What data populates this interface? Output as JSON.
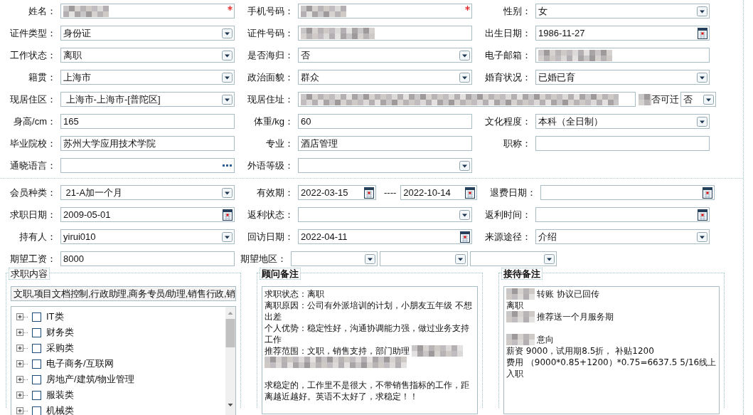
{
  "personal": {
    "rows": [
      [
        {
          "label": "姓名：",
          "kind": "text",
          "redacted": true,
          "required": true
        },
        {
          "label": "手机号码：",
          "kind": "text",
          "redacted": true,
          "required": true
        },
        {
          "label": "性别：",
          "kind": "select",
          "value": "女"
        }
      ],
      [
        {
          "label": "证件类型：",
          "kind": "select",
          "value": "身份证"
        },
        {
          "label": "证件号码：",
          "kind": "text",
          "redacted": true
        },
        {
          "label": "出生日期：",
          "kind": "date",
          "value": "1986-11-27"
        }
      ],
      [
        {
          "label": "工作状态：",
          "kind": "select",
          "value": "离职"
        },
        {
          "label": "是否海归：",
          "kind": "select",
          "value": "否"
        },
        {
          "label": "电子邮箱：",
          "kind": "text",
          "redacted": true
        }
      ],
      [
        {
          "label": "籍贯：",
          "kind": "select",
          "value": "上海市"
        },
        {
          "label": "政治面貌：",
          "kind": "select",
          "value": "群众"
        },
        {
          "label": "婚育状况：",
          "kind": "select",
          "value": "已婚已育"
        }
      ],
      [
        {
          "label": "现居住区：",
          "kind": "select",
          "value": " 上海市-上海市-[普陀区]"
        },
        {
          "label": "现居住址：",
          "kind": "wide",
          "redacted": true,
          "extra": {
            "label": "否可迁",
            "label_redacted": true,
            "kind": "select",
            "value": "否"
          }
        }
      ],
      [
        {
          "label": "身高/cm：",
          "kind": "text",
          "value": "165"
        },
        {
          "label": "体重/kg：",
          "kind": "text",
          "value": "60"
        },
        {
          "label": "文化程度：",
          "kind": "select",
          "value": "本科（全日制）"
        }
      ],
      [
        {
          "label": "毕业院校：",
          "kind": "text",
          "value": "苏州大学应用技术学院"
        },
        {
          "label": "专业：",
          "kind": "text",
          "value": "酒店管理"
        },
        {
          "label": "职称：",
          "kind": "text"
        }
      ],
      [
        {
          "label": "通晓语言：",
          "kind": "lookup"
        },
        {
          "label": "外语等级：",
          "kind": "select"
        }
      ]
    ]
  },
  "membership": {
    "rows": [
      [
        {
          "label": "会员种类：",
          "kind": "select",
          "value": " 21-A加一个月"
        },
        {
          "label": "有效期：",
          "kind": "range",
          "separator": "----",
          "parts": [
            {
              "kind": "date",
              "value": "2022-03-15"
            },
            {
              "kind": "date",
              "value": "2022-10-14"
            }
          ]
        },
        {
          "label": "退费日期：",
          "kind": "date"
        }
      ],
      [
        {
          "label": "求职日期：",
          "kind": "date",
          "value": "2009-05-01"
        },
        {
          "label": "返利状态：",
          "kind": "select"
        },
        {
          "label": "返利时间：",
          "kind": "date"
        }
      ],
      [
        {
          "label": "持有人：",
          "kind": "select",
          "value": "yirui010"
        },
        {
          "label": "回访日期：",
          "kind": "date",
          "value": "2022-04-11"
        },
        {
          "label": "来源途径：",
          "kind": "select",
          "value": "介绍"
        }
      ],
      [
        {
          "label": "期望工资：",
          "kind": "text",
          "value": "8000"
        },
        {
          "label": "期望地区：",
          "kind": "multi",
          "parts": [
            {
              "kind": "select"
            },
            {
              "kind": "select"
            },
            {
              "kind": "select"
            }
          ]
        }
      ]
    ]
  },
  "job_wanted": {
    "title": "求职内容",
    "value": "文职,项目文档控制,行政助理,商务专员/助理,销售行政,销",
    "tree": [
      {
        "label": "IT类",
        "checked": false,
        "expanded": false
      },
      {
        "label": "财务类",
        "checked": false,
        "expanded": false
      },
      {
        "label": "采购类",
        "checked": false,
        "expanded": false
      },
      {
        "label": "电子商务/互联网",
        "checked": false,
        "expanded": false
      },
      {
        "label": "房地产/建筑/物业管理",
        "checked": false,
        "expanded": false
      },
      {
        "label": "服装类",
        "checked": false,
        "expanded": false
      },
      {
        "label": "机械类",
        "checked": false,
        "expanded": false
      }
    ]
  },
  "notes": [
    {
      "title": "顾问备注",
      "lines": [
        {
          "text": "求职状态：离职"
        },
        {
          "text": "离职原因：公司有外派培训的计划，小朋友五年级 不想出差"
        },
        {
          "text": "个人优势：稳定性好，沟通协调能力强，做过业务支持工作"
        },
        {
          "text": "推荐范围：文职，销售支持，部门助理",
          "masked_after": true
        },
        {
          "text": "求稳定的，工作里不是很大，不带销售指标的工作，距离越近越好。英语不太好了，求稳定！！",
          "blank_before": true
        }
      ]
    },
    {
      "title": "接待备注",
      "lines": [
        {
          "text": "转账 协议已回传",
          "masked_before": true
        },
        {
          "text": "离职"
        },
        {
          "text": "推荐送一个月服务期",
          "masked_before": true
        },
        {
          "text": "意向",
          "masked_before": true,
          "blank_before": true
        },
        {
          "text": "薪资 9000，试用期8.5折， 补贴1200"
        },
        {
          "text": "费用 （9000*0.85+1200）*0.75=6637.5  5/16线上入职"
        }
      ]
    }
  ]
}
